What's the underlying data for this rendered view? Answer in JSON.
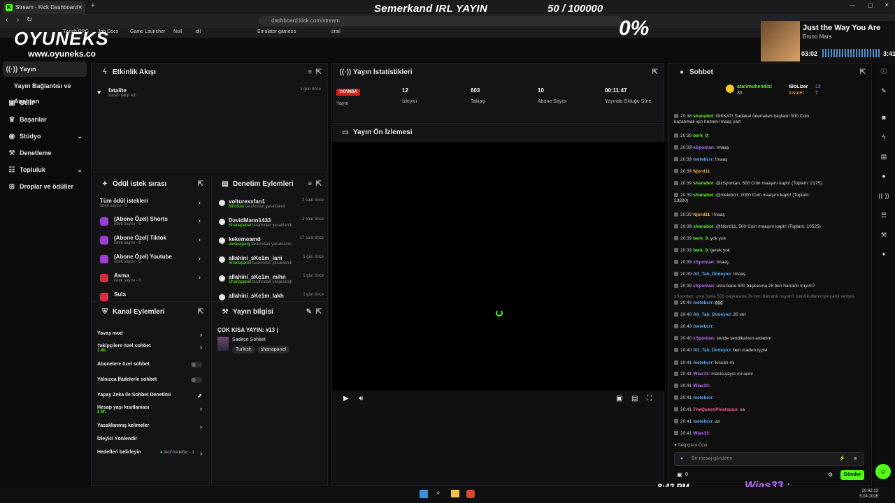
{
  "browser": {
    "tab_title": "Stream - Kick Dashboard",
    "url": "dashboard.kick.com/stream",
    "bookmarks": [
      "Twitch RPG",
      "Job Docs",
      "Game Launcher",
      "Null",
      "dil",
      "Emulator games",
      "s",
      "srail"
    ]
  },
  "overlay": {
    "stream_title": "Semerkand IRL YAYIN",
    "goal": "50 / 100000",
    "goal_pct": "0%",
    "logo": "OYUNEKS",
    "logo_url": "www.oyuneks.co",
    "clock": "8:42 PM",
    "name": "Wias33 :"
  },
  "music": {
    "title": "Just the Way You Are",
    "artist": "Bruno Mars",
    "time": "03:02",
    "end": "3:41"
  },
  "sidebar": {
    "items": [
      {
        "label": "Yayın",
        "icon": "stream-icon"
      },
      {
        "label": "Yayın Bağlantısı ve Anahtarı",
        "icon": ""
      },
      {
        "label": "Gelir",
        "icon": "money-icon"
      },
      {
        "label": "Başarılar",
        "icon": "trophy-icon"
      },
      {
        "label": "Stüdyo",
        "icon": "studio-icon"
      },
      {
        "label": "Denetleme",
        "icon": "wrench-icon"
      },
      {
        "label": "Topluluk",
        "icon": "community-icon"
      },
      {
        "label": "Droplar ve ödüller",
        "icon": "gift-icon"
      }
    ]
  },
  "activity": {
    "title": "Etkinlik Akışı",
    "items": [
      {
        "user": "fatalite",
        "text": "kanalı takip etti",
        "time": "1 gün önce"
      }
    ]
  },
  "stats": {
    "title": "Yayın İstatistikleri",
    "live_badge": "YAYINDA",
    "live_label": "Yayın",
    "cols": [
      {
        "value": "12",
        "label": "İzleyici"
      },
      {
        "value": "603",
        "label": "Takipçi"
      },
      {
        "value": "10",
        "label": "Abone Sayısı"
      },
      {
        "value": "00:11:47",
        "label": "Yayında Olduğu Süre"
      }
    ]
  },
  "preview": {
    "title": "Yayın Ön İzlemesi"
  },
  "rewards": {
    "title": "Ödül istek sırası",
    "items": [
      {
        "title": "Tüm ödül istekleri",
        "sub": "İstek sayısı - 0"
      },
      {
        "title": "(Abone Özel) Shorts",
        "sub": "İstek sayısı - 0"
      },
      {
        "title": "(Abone Özel) Tiktok",
        "sub": "İstek sayısı - 0"
      },
      {
        "title": "(Abone Özel) Youtube",
        "sub": "İstek sayısı - 0"
      },
      {
        "title": "Asma",
        "sub": "İstek sayısı - 0"
      },
      {
        "title": "Sula",
        "sub": ""
      }
    ]
  },
  "mod": {
    "title": "Denetim Eylemleri",
    "items": [
      {
        "user": "volturexxfan1",
        "by": "Mito81w",
        "text": "tarafından yasaklandı",
        "time": "2 saat önce"
      },
      {
        "user": "DavidMann1433",
        "by": "Shanapanel",
        "text": "tarafından yasaklandı",
        "time": "3 saat önce"
      },
      {
        "user": "kekemeamd",
        "by": "aloskegang",
        "text": "tarafından yasaklandı",
        "time": "17 saat önce"
      },
      {
        "user": "allahini_sKe1m_iani",
        "by": "Shanapanel",
        "text": "tarafından yasaklandı",
        "time": "1 gün önce"
      },
      {
        "user": "allahini_sKe1m_mihn",
        "by": "Shanapanel",
        "text": "tarafından yasaklandı",
        "time": "1 gün önce"
      },
      {
        "user": "allahini_sKe1m_lakh",
        "by": "",
        "text": "",
        "time": "1 gün önce"
      }
    ]
  },
  "channel": {
    "title": "Kanal Eylemleri",
    "items": [
      {
        "label": "Yavaş mod",
        "sub": "",
        "ctl": "chevron"
      },
      {
        "label": "Takipçilere özel sohbet",
        "sub": "1 dk.",
        "ctl": "chevron"
      },
      {
        "label": "Abonelere özel sohbet",
        "sub": "",
        "ctl": "toggle"
      },
      {
        "label": "Yalnızca İfadelerle sohbet",
        "sub": "",
        "ctl": "toggle"
      },
      {
        "label": "Yapay Zeka ile Sohbet Denetimi",
        "sub": "",
        "ctl": "external"
      },
      {
        "label": "Hesap yaşı kısıtlaması",
        "sub": "1 hf.",
        "ctl": "chevron"
      },
      {
        "label": "Yasaklanmış kelimeler",
        "sub": "",
        "ctl": "chevron"
      },
      {
        "label": "İzleyici Yönlendir",
        "sub": "",
        "ctl": ""
      },
      {
        "label": "Hedefleri belirleyin",
        "sub": "",
        "ctl": "chevron"
      }
    ],
    "goals_badge": "Aktif hedefler - 1"
  },
  "info": {
    "title": "Yayın bilgisi",
    "stream_name": "ÇOK KISA YAYIN: #13 |",
    "category": "Sadece Sohbet",
    "tags": [
      "Turkish",
      "shanapanel"
    ]
  },
  "chat": {
    "title": "Sohbet",
    "leader": [
      {
        "name": "atarimuhendisi",
        "value": "35"
      },
      {
        "name": "IBoLizer",
        "value": "13"
      },
      {
        "name": "Insurer",
        "value": "7"
      }
    ],
    "messages": [
      {
        "ts": "20:38",
        "user": "shanabot",
        "color": "#53fc18",
        "text": "DİKKAT! Sadakat ödemeleri başladı! 500 Coin"
      },
      {
        "ts": "",
        "user": "",
        "color": "#ddd",
        "text": "kazanmak için hemen !maaş yaz!"
      },
      {
        "ts": "20:39",
        "user": "berk_9",
        "color": "#53fc18",
        "text": ""
      },
      {
        "ts": "20:39",
        "user": "xSpontan",
        "color": "#c26bff",
        "text": "!maaş"
      },
      {
        "ts": "20:39",
        "user": "metebcrr",
        "color": "#5ab0ff",
        "text": "!maaş"
      },
      {
        "ts": "20:39",
        "user": "Njord11",
        "color": "#ffb347",
        "text": ""
      },
      {
        "ts": "20:39",
        "user": "shanabot",
        "color": "#53fc18",
        "text": "@xSpontan, 500 Coin maaşını kaptı! (Toplam: 2175)"
      },
      {
        "ts": "20:39",
        "user": "shanabot",
        "color": "#53fc18",
        "text": "@metebcrr, 2000 Coin maaşını kaptı! (Toplam:"
      },
      {
        "ts": "",
        "user": "",
        "color": "#ddd",
        "text": "23800)"
      },
      {
        "ts": "20:39",
        "user": "Njord11",
        "color": "#ffb347",
        "text": "!maaş"
      },
      {
        "ts": "20:39",
        "user": "shanabot",
        "color": "#53fc18",
        "text": "@Njord11, 500 Coin maaşını kaptı! (Toplam: 10525)"
      },
      {
        "ts": "20:39",
        "user": "berk_9",
        "color": "#53fc18",
        "text": "yok yok"
      },
      {
        "ts": "20:39",
        "user": "berk_9",
        "color": "#53fc18",
        "text": "gerek yok"
      },
      {
        "ts": "20:39",
        "user": "xSpontan",
        "color": "#c26bff",
        "text": "!maaş"
      },
      {
        "ts": "20:39",
        "user": "Alt_Tab_Dinleyici",
        "color": "#5ab0ff",
        "text": "!maaş"
      },
      {
        "ts": "20:39",
        "user": "xSpontan",
        "color": "#c26bff",
        "text": "usta bana 500 başkasına 2k ben harranlı mıyım?"
      },
      {
        "ts": "",
        "user": "",
        "color": "#777",
        "text": "xSpontan: usta bana 500 başkasına 2k ben harranlı mıyım? isimli kullanıcıya yanıt veriyor"
      },
      {
        "ts": "20:40",
        "user": "metebcrr",
        "color": "#5ab0ff",
        "text": "ğğğ"
      },
      {
        "ts": "20:40",
        "user": "Alt_Tab_Dinleyici",
        "color": "#5ab0ff",
        "text": "20 ver"
      },
      {
        "ts": "20:40",
        "user": "metebcrr",
        "color": "#5ab0ff",
        "text": ""
      },
      {
        "ts": "20:40",
        "user": "xSpontan",
        "color": "#c26bff",
        "text": "sende sendikalısın anladım"
      },
      {
        "ts": "20:40",
        "user": "Alt_Tab_Dinleyici",
        "color": "#5ab0ff",
        "text": "ben maden işçisi"
      },
      {
        "ts": "20:41",
        "user": "metebcrr",
        "color": "#5ab0ff",
        "text": "kıscan mı"
      },
      {
        "ts": "20:41",
        "user": "Wias33",
        "color": "#c26bff",
        "text": "macta yayın mı acılır"
      },
      {
        "ts": "20:41",
        "user": "Wias33",
        "color": "#c26bff",
        "text": ""
      },
      {
        "ts": "20:41",
        "user": "metebcrr",
        "color": "#5ab0ff",
        "text": ""
      },
      {
        "ts": "20:41",
        "user": "TheQueenPolatsuuu",
        "color": "#ff5a8a",
        "text": "sa"
      },
      {
        "ts": "20:41",
        "user": "metebcrr",
        "color": "#5ab0ff",
        "text": "as"
      },
      {
        "ts": "20:41",
        "user": "Wias33",
        "color": "#c26bff",
        "text": ""
      }
    ],
    "followers_only": "Takipçilere Özel",
    "input_placeholder": "Bir mesaj gönderin",
    "count": "0",
    "send": "Gönder"
  },
  "taskbar": {
    "time": "20:42:13",
    "date": "5.04.2026"
  }
}
